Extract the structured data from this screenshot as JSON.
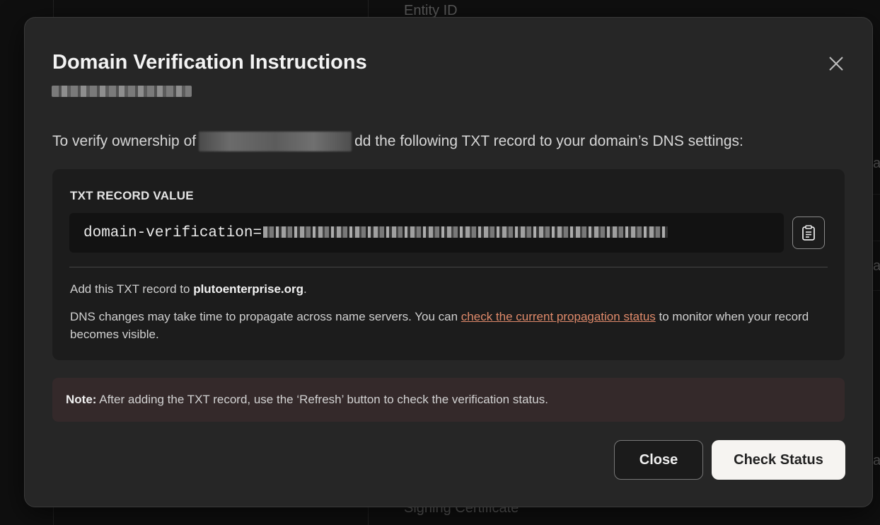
{
  "background": {
    "top_label": "Entity ID",
    "bottom_label": "Signing Certificate",
    "edge_char": "a"
  },
  "modal": {
    "title": "Domain Verification Instructions",
    "intro_prefix": "To verify ownership of",
    "intro_suffix": "dd the following TXT record to your domain’s DNS settings:",
    "record": {
      "label": "TXT RECORD VALUE",
      "value_prefix": "domain-verification=",
      "copy_icon": "clipboard-icon"
    },
    "add_prefix": "Add this TXT record to ",
    "add_domain": "plutoenterprise.org",
    "add_suffix": ".",
    "dns_before": "DNS changes may take time to propagate across name servers. You can ",
    "dns_link": "check the current propagation status",
    "dns_after": " to monitor when your record becomes visible.",
    "note_label": "Note:",
    "note_text": " After adding the TXT record, use the ‘Refresh’ button to check the verification status.",
    "buttons": {
      "close": "Close",
      "check_status": "Check Status"
    }
  },
  "colors": {
    "link": "#e08a6a",
    "note_bg": "#34292a",
    "primary_btn_bg": "#f6f4f1"
  }
}
